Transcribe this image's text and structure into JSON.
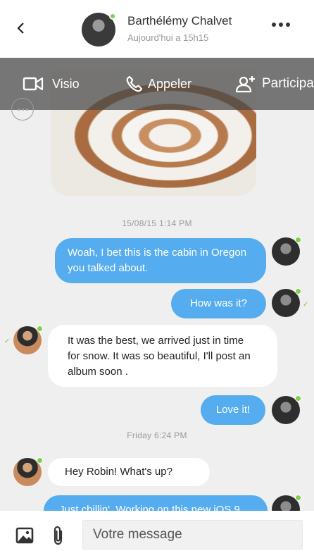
{
  "header": {
    "contact_name": "Barthélémy Chalvet",
    "last_seen": "Aujourd'hui a 15h15"
  },
  "actions": {
    "video_label": "Visio",
    "call_label": "Appeler",
    "participants_label": "Participa"
  },
  "timestamps": [
    "15/08/15  1:14 PM",
    "Friday 6:24 PM"
  ],
  "messages": [
    {
      "text": "Woah, I bet this is the cabin in Oregon you talked about."
    },
    {
      "text": "How was it?"
    },
    {
      "text": "It was the best, we arrived just in time for snow. It was so beautiful, I'll post an album soon ."
    },
    {
      "text": "Love it!"
    },
    {
      "text": "Hey Robin! What's up?"
    },
    {
      "text": "Just chillin'. Working on this new iOS 9"
    }
  ],
  "composer": {
    "placeholder": "Votre message"
  },
  "colors": {
    "outgoing_bubble": "#55acee",
    "online": "#7bd14b",
    "read_check": "#8dc63f"
  }
}
